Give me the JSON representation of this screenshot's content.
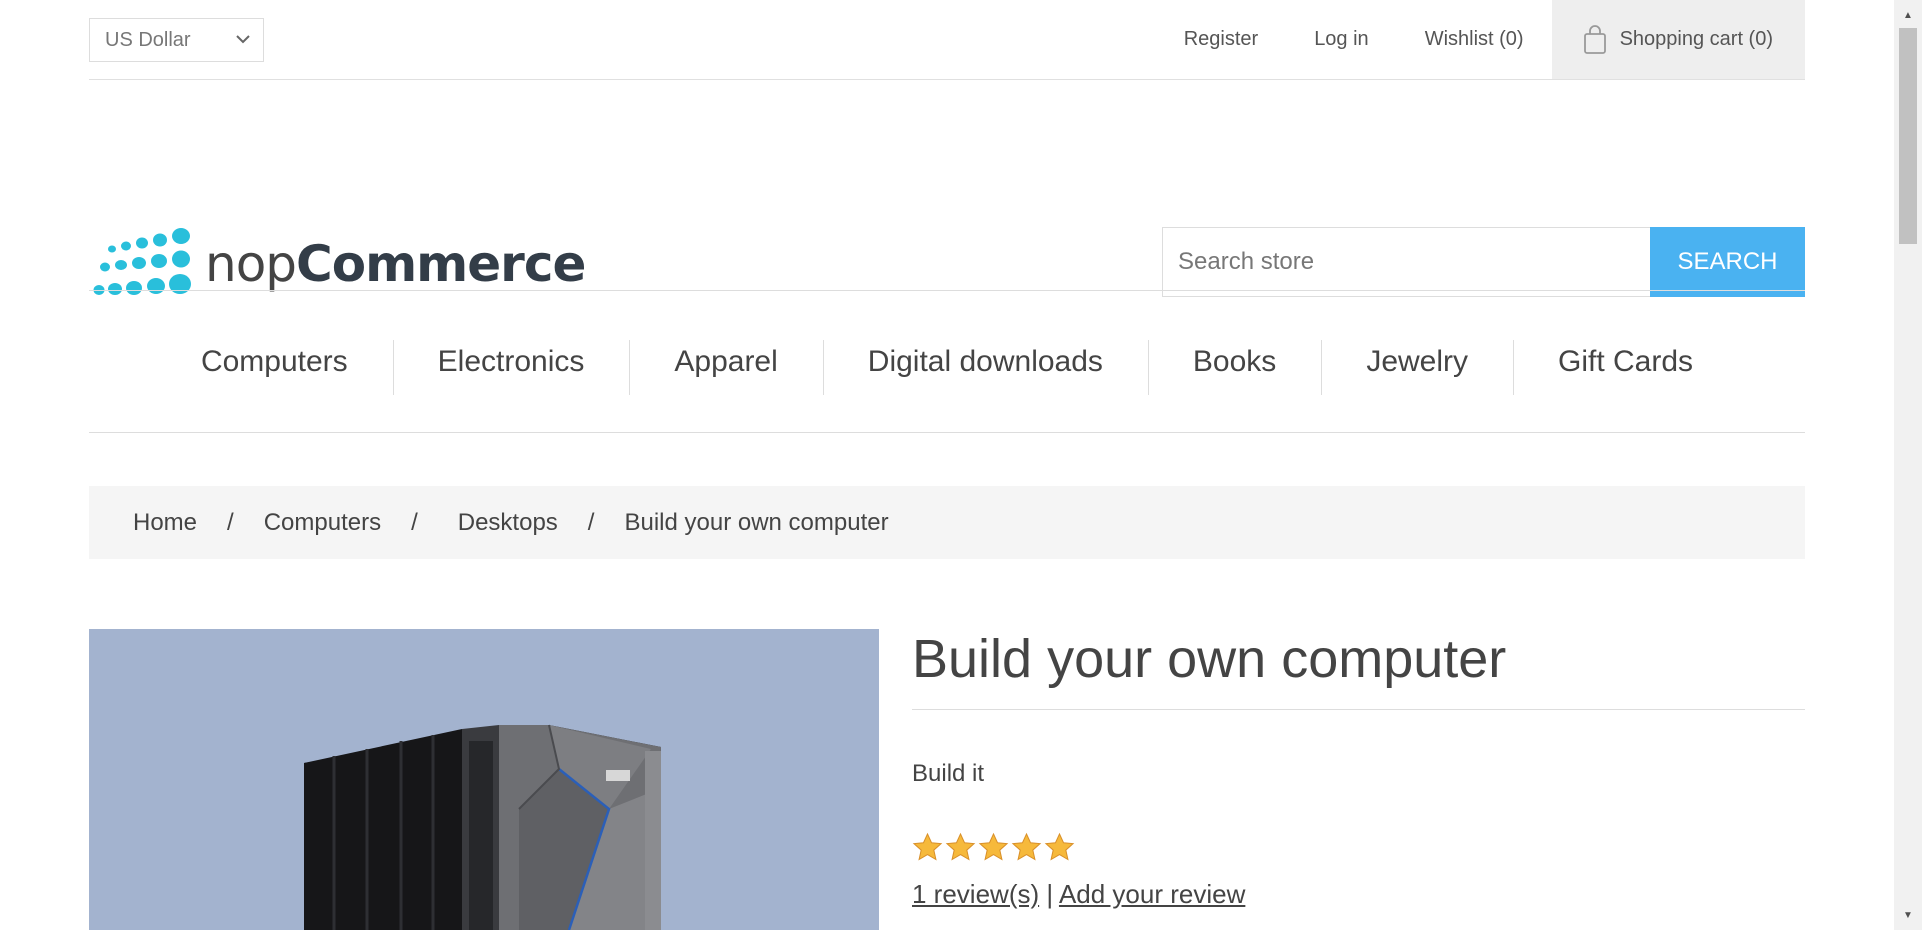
{
  "header": {
    "currency": "US Dollar",
    "links": {
      "register": "Register",
      "login": "Log in",
      "wishlist": "Wishlist (0)",
      "cart": "Shopping cart (0)"
    }
  },
  "logo": {
    "nop": "nop",
    "commerce": "Commerce"
  },
  "search": {
    "placeholder": "Search store",
    "button": "SEARCH"
  },
  "menu": {
    "items": [
      "Computers",
      "Electronics",
      "Apparel",
      "Digital downloads",
      "Books",
      "Jewelry",
      "Gift Cards"
    ]
  },
  "breadcrumb": {
    "items": [
      "Home",
      "Computers",
      "Desktops",
      "Build your own computer"
    ],
    "separator": "/"
  },
  "product": {
    "title": "Build your own computer",
    "short_description": "Build it",
    "rating_stars": 5,
    "reviews_link": "1 review(s)",
    "separator": "|",
    "add_review": "Add your review"
  },
  "icons": {
    "cart": "shopping-bag-icon",
    "currency": "chevron-down-icon",
    "star": "star-icon"
  },
  "colors": {
    "accent": "#4ab2f1",
    "logo_dots": "#29bfdb",
    "image_bg": "#a3b3cf",
    "star": "#f6b93b"
  }
}
